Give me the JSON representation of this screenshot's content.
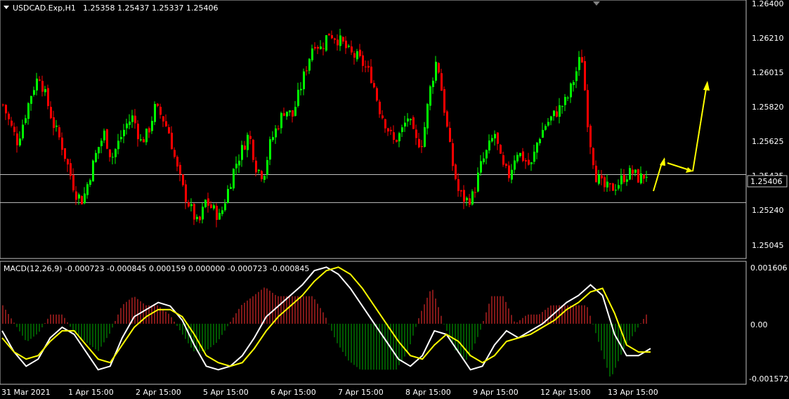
{
  "main_chart": {
    "symbol_timeframe": "USDCAD.Exp,H1",
    "ohlc": "1.25358 1.25437 1.25337 1.25406",
    "current_price_label": "1.25406",
    "price_ticks": [
      "1.26400",
      "1.26210",
      "1.26015",
      "1.25820",
      "1.25625",
      "1.25435",
      "1.25240",
      "1.25045"
    ],
    "horizontal_levels": [
      1.25406,
      1.2524
    ],
    "colors": {
      "bull": "#00ff00",
      "bear": "#ff0000",
      "arrow": "#ffff00",
      "level": "#c0c0c0"
    }
  },
  "indicator": {
    "label": "MACD(12,26,9) -0.000723 -0.000845 0.000159 0.000000 -0.000723 -0.000845",
    "ticks": [
      "0.001606",
      "0.00",
      "-0.001572"
    ],
    "colors": {
      "macd": "#ffffff",
      "signal": "#ffff00",
      "hist_pos": "#ff3030",
      "hist_neg": "#00b000"
    }
  },
  "time_axis": {
    "labels": [
      "31 Mar 2021",
      "1 Apr 15:00",
      "2 Apr 15:00",
      "5 Apr 15:00",
      "6 Apr 15:00",
      "7 Apr 15:00",
      "8 Apr 15:00",
      "9 Apr 15:00",
      "12 Apr 15:00",
      "13 Apr 15:00"
    ]
  },
  "chart_data": {
    "type": "candlestick",
    "price_path": [
      1.2582,
      1.257,
      1.256,
      1.2575,
      1.259,
      1.26,
      1.2585,
      1.257,
      1.256,
      1.2545,
      1.253,
      1.2525,
      1.254,
      1.2555,
      1.2565,
      1.255,
      1.256,
      1.257,
      1.2575,
      1.256,
      1.2565,
      1.258,
      1.2575,
      1.2565,
      1.2545,
      1.253,
      1.252,
      1.251,
      1.2525,
      1.252,
      1.2515,
      1.253,
      1.2545,
      1.2555,
      1.2565,
      1.2545,
      1.254,
      1.256,
      1.257,
      1.258,
      1.2575,
      1.259,
      1.2605,
      1.262,
      1.2615,
      1.2625,
      1.2622,
      1.2618,
      1.2612,
      1.261,
      1.2605,
      1.2598,
      1.258,
      1.257,
      1.256,
      1.2565,
      1.2575,
      1.256,
      1.256,
      1.259,
      1.261,
      1.258,
      1.255,
      1.253,
      1.2525,
      1.2528,
      1.2545,
      1.2555,
      1.2565,
      1.2545,
      1.254,
      1.2555,
      1.255,
      1.2545,
      1.2562,
      1.257,
      1.2575,
      1.258,
      1.2585,
      1.2598,
      1.2612,
      1.2565,
      1.254,
      1.2533,
      1.2532,
      1.2535,
      1.254,
      1.2542,
      1.2538,
      1.2541
    ],
    "macd_path": [
      -0.0002,
      -0.0008,
      -0.0012,
      -0.001,
      -0.0004,
      -0.0001,
      -0.0003,
      -0.0008,
      -0.0013,
      -0.0012,
      -0.0004,
      0.0002,
      0.0004,
      0.0006,
      0.0005,
      0.0001,
      -0.0006,
      -0.0012,
      -0.0013,
      -0.0012,
      -0.0009,
      -0.0004,
      0.0002,
      0.0005,
      0.0008,
      0.0011,
      0.0015,
      0.0016,
      0.0014,
      0.001,
      0.0005,
      0.0,
      -0.0005,
      -0.001,
      -0.0012,
      -0.0009,
      -0.0002,
      -0.0003,
      -0.0008,
      -0.0013,
      -0.0012,
      -0.0006,
      -0.0002,
      -0.0004,
      -0.0002,
      0.0,
      0.0003,
      0.0006,
      0.0008,
      0.0011,
      0.0008,
      -0.0003,
      -0.0009,
      -0.0009,
      -0.0007
    ],
    "signal_path": [
      -0.0004,
      -0.0008,
      -0.001,
      -0.0009,
      -0.0005,
      -0.0002,
      -0.0002,
      -0.0006,
      -0.001,
      -0.0011,
      -0.0006,
      -0.0001,
      0.0002,
      0.0004,
      0.0004,
      0.0002,
      -0.0003,
      -0.0009,
      -0.0011,
      -0.0012,
      -0.0011,
      -0.0007,
      -0.0002,
      0.0002,
      0.0005,
      0.0008,
      0.0012,
      0.0015,
      0.0016,
      0.0014,
      0.001,
      0.0005,
      0.0,
      -0.0005,
      -0.0009,
      -0.001,
      -0.0006,
      -0.0003,
      -0.0005,
      -0.0009,
      -0.0011,
      -0.0009,
      -0.0005,
      -0.0004,
      -0.0003,
      -0.0001,
      0.0001,
      0.0004,
      0.0006,
      0.0009,
      0.001,
      0.0003,
      -0.0006,
      -0.0008,
      -0.0008
    ],
    "ylim": [
      1.2495,
      1.2642
    ],
    "macd_ylim": [
      -0.001572,
      0.001606
    ]
  }
}
